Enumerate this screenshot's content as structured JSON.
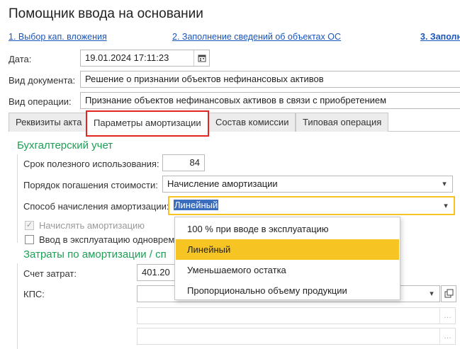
{
  "window": {
    "title": "Помощник ввода на основании"
  },
  "steps": [
    {
      "label": "1. Выбор кап. вложения"
    },
    {
      "label": "2. Заполнение сведений об объектах ОС"
    },
    {
      "label": "3. Заполн"
    }
  ],
  "header": {
    "date_label": "Дата:",
    "date_value": "19.01.2024 17:11:23",
    "doc_type_label": "Вид документа:",
    "doc_type_value": "Решение о признании объектов нефинансовых активов",
    "operation_label": "Вид операции:",
    "operation_value": "Признание объектов нефинансовых активов в связи с приобретением"
  },
  "tabs": [
    {
      "label": "Реквизиты акта"
    },
    {
      "label": "Параметры амортизации"
    },
    {
      "label": "Состав комиссии"
    },
    {
      "label": "Типовая операция"
    }
  ],
  "accounting": {
    "section_title": "Бухгалтерский учет",
    "useful_life_label": "Срок полезного использования:",
    "useful_life_value": "84",
    "repayment_label": "Порядок погашения стоимости:",
    "repayment_value": "Начисление амортизации",
    "method_label": "Способ начисления амортизации:",
    "method_value": "Линейный",
    "accrue_label": "Начислять амортизацию",
    "commission_label": "Ввод в эксплуатацию одноврем"
  },
  "costs": {
    "section_title": "Затраты по амортизации / сп",
    "account_label": "Счет затрат:",
    "account_value": "401.20",
    "kps_label": "КПС:"
  },
  "dropdown": {
    "options": [
      {
        "label": "100 % при вводе в эксплуатацию"
      },
      {
        "label": "Линейный"
      },
      {
        "label": "Уменьшаемого остатка"
      },
      {
        "label": "Пропорционально объему продукции"
      }
    ],
    "selected": "Линейный"
  },
  "colors": {
    "link": "#1a55b8",
    "section_title": "#1d9f55",
    "highlight": "#f6c524",
    "tab_highlight": "#e0261e",
    "selection": "#3a6dbd"
  }
}
